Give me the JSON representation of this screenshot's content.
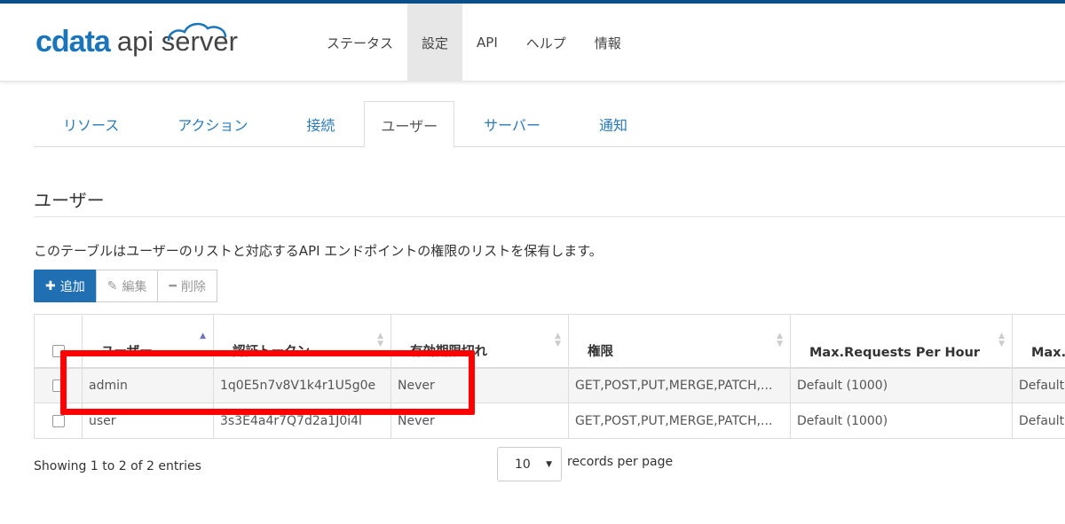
{
  "header": {
    "logo_cdata": "cdata",
    "logo_product": "api server",
    "nav": [
      "ステータス",
      "設定",
      "API",
      "ヘルプ",
      "情報"
    ],
    "active_nav": "設定"
  },
  "tabs": [
    "リソース",
    "アクション",
    "接続",
    "ユーザー",
    "サーバー",
    "通知"
  ],
  "active_tab": "ユーザー",
  "section": {
    "title": "ユーザー",
    "description": "このテーブルはユーザーのリストと対応するAPI エンドポイントの権限のリストを保有します。"
  },
  "toolbar": {
    "add_label": "追加",
    "edit_label": "編集",
    "delete_label": "削除"
  },
  "table": {
    "columns": [
      "ユーザー",
      "認証トークン",
      "有効期限切れ",
      "権限",
      "Max.Requests Per Hour",
      "Max."
    ],
    "rows": [
      [
        "admin",
        "1q0E5n7v8V1k4r1U5g0e",
        "Never",
        "GET,POST,PUT,MERGE,PATCH,...",
        "Default (1000)",
        "Default"
      ],
      [
        "user",
        "3s3E4a4r7Q7d2a1J0i4l",
        "Never",
        "GET,POST,PUT,MERGE,PATCH,...",
        "Default (1000)",
        "Default"
      ]
    ]
  },
  "footer": {
    "info": "Showing 1 to 2 of 2 entries",
    "page_size": "10",
    "page_size_label": "records per page"
  },
  "colors": {
    "brand_blue": "#1b75bb",
    "primary_button": "#1f6fb2",
    "highlight_box": "#ff0000",
    "tab_link": "#2a7ab8"
  }
}
